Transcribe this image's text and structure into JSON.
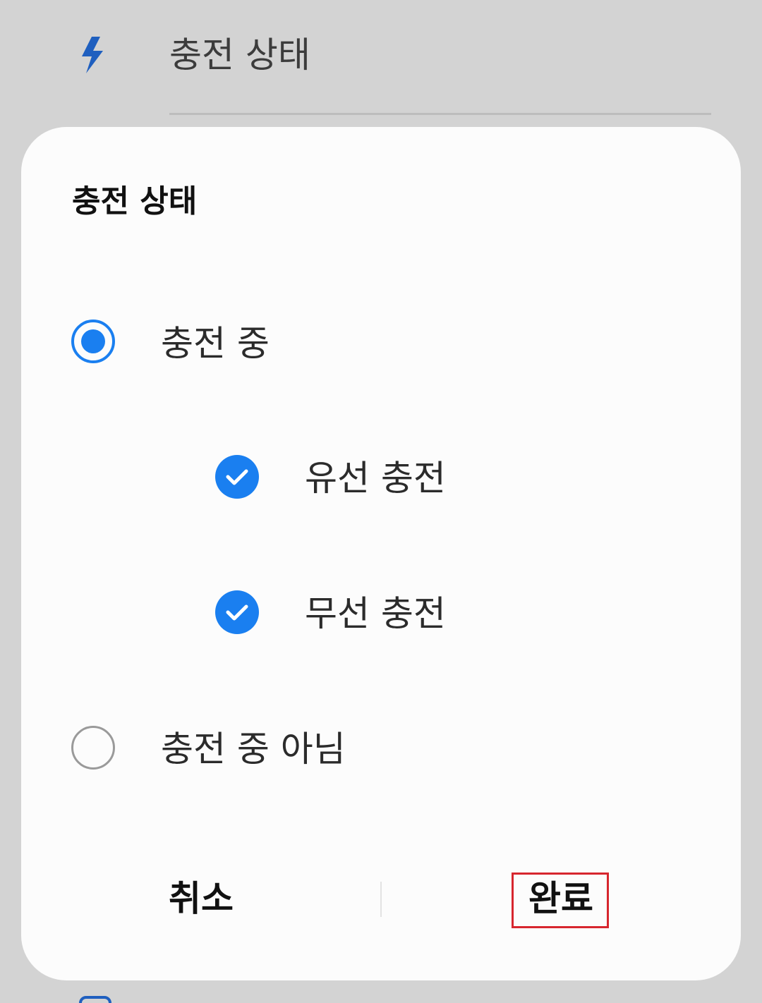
{
  "background": {
    "row_title": "충전 상태",
    "icon": "lightning-bolt-icon"
  },
  "dialog": {
    "title": "충전 상태",
    "options": [
      {
        "label": "충전 중",
        "selected": true
      },
      {
        "label": "충전 중 아님",
        "selected": false
      }
    ],
    "sub_options": [
      {
        "label": "유선 충전",
        "checked": true
      },
      {
        "label": "무선 충전",
        "checked": true
      }
    ],
    "cancel_label": "취소",
    "done_label": "완료"
  },
  "colors": {
    "accent": "#1a7ff0",
    "highlight": "#d7262e"
  }
}
